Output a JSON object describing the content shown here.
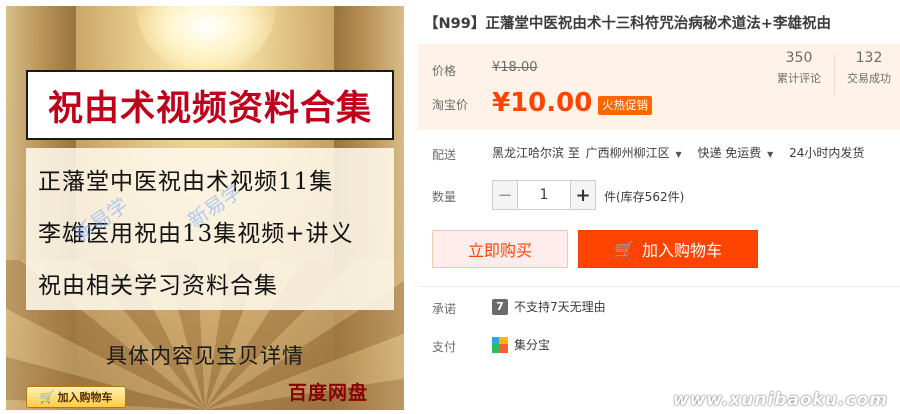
{
  "product_image": {
    "banner_title": "祝由术视频资料合集",
    "lines": [
      "正藩堂中医祝由术视频11集",
      "李雄医用祝由13集视频+讲义",
      "祝由相关学习资料合集"
    ],
    "watermark_text": "新易学",
    "detail_note": "具体内容见宝贝详情",
    "cart_badge": "加入购物车",
    "cloud_label": "百度网盘"
  },
  "product": {
    "title": "【N99】正藩堂中医祝由术十三科符咒治病秘术道法+李雄祝由"
  },
  "price": {
    "original_label": "价格",
    "original_value": "¥18.00",
    "current_label": "淘宝价",
    "current_value": "¥10.00",
    "promo_badge": "火热促销"
  },
  "stats": {
    "reviews_count": "350",
    "reviews_label": "累计评论",
    "sales_count": "132",
    "sales_label": "交易成功"
  },
  "shipping": {
    "label": "配送",
    "from": "黑龙江哈尔滨 至",
    "to": "广西柳州柳江区",
    "method": "快递 免运费",
    "dispatch": "24小时内发货"
  },
  "quantity": {
    "label": "数量",
    "value": "1",
    "minus": "−",
    "plus": "+",
    "stock_note": "件(库存562件)"
  },
  "actions": {
    "buy_now": "立即购买",
    "add_to_cart": "加入购物车"
  },
  "promise": {
    "label": "承诺",
    "icon_text": "7",
    "text": "不支持7天无理由"
  },
  "payment": {
    "label": "支付",
    "text": "集分宝"
  },
  "site_watermark": "www.xunibaoku.com",
  "colors": {
    "accent": "#ff4400",
    "price_bg": "#fff2e8",
    "promo_badge": "#ff6600",
    "banner_text": "#c0001b"
  },
  "icons": {
    "dropdown": "caret-down-icon",
    "cart": "shopping-cart-icon",
    "promise": "seven-day-icon",
    "payment": "jifenbao-icon"
  }
}
